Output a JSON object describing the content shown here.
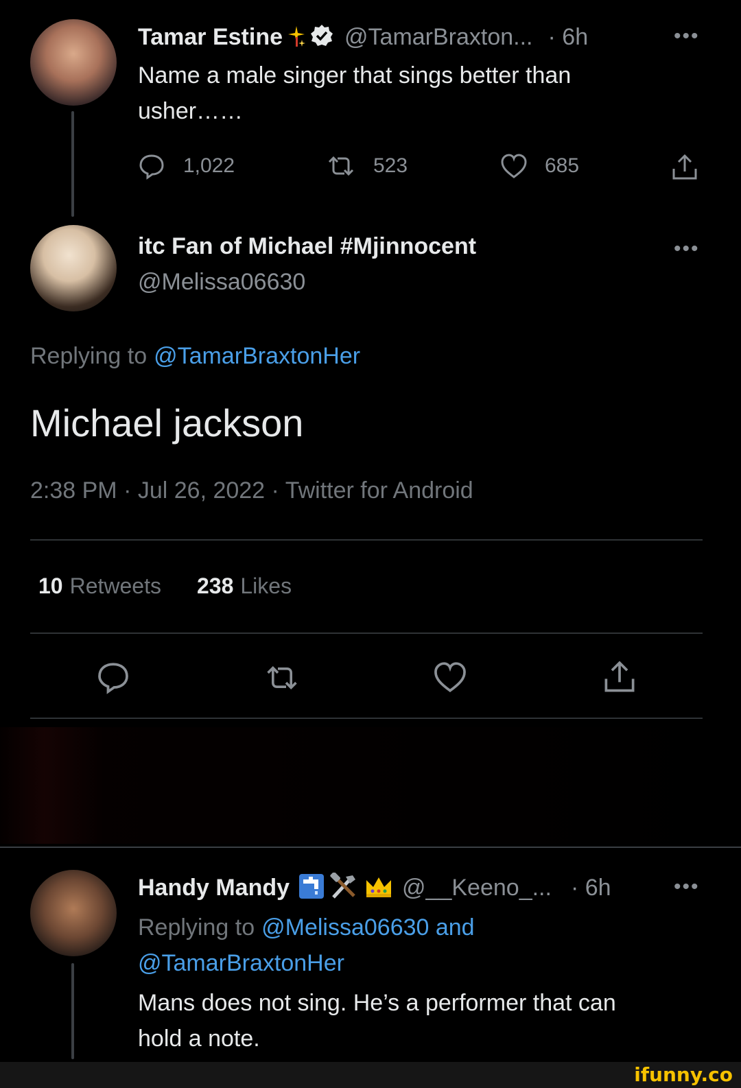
{
  "tweet1": {
    "display_name": "Tamar Estine",
    "handle": "@TamarBraxton...",
    "time": "· 6h",
    "text_line1": "Name a male singer that sings better than",
    "text_line2": "usher……",
    "replies": "1,022",
    "retweets": "523",
    "likes": "685",
    "more": "•••"
  },
  "tweet2": {
    "display_name": "itc Fan of Michael #Mjinnocent",
    "handle": "@Melissa06630",
    "more": "•••",
    "replying_label": "Replying to",
    "replying_handle": "@TamarBraxtonHer",
    "text": "Michael jackson",
    "meta": "2:38 PM · Jul 26, 2022 · Twitter for Android",
    "retweet_count": "10",
    "retweet_label": "Retweets",
    "like_count": "238",
    "like_label": "Likes"
  },
  "tweet3": {
    "display_name": "Handy Mandy",
    "handle": "@__Keeno_...",
    "time": "· 6h",
    "more": "•••",
    "replying_label": "Replying to",
    "replying_handles": "@Melissa06630 and",
    "replying_handle2": "@TamarBraxtonHer",
    "text_line1": "Mans does not sing. He’s a performer that can",
    "text_line2": "hold a note."
  },
  "watermark": "ifunny.co",
  "colors": {
    "background": "#000000",
    "text": "#e7e9ea",
    "muted": "#71767b",
    "link": "#4a9fe8",
    "divider": "#2f3336"
  }
}
